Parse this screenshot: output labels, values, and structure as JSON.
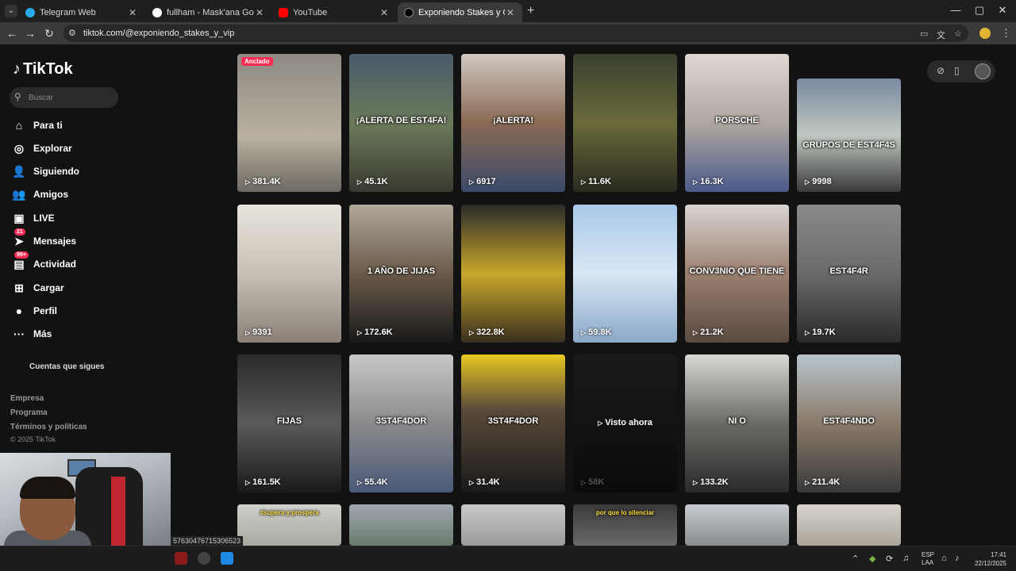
{
  "browser": {
    "tabs": [
      {
        "title": "Telegram Web",
        "color": "#2aabee",
        "active": false
      },
      {
        "title": "fullham - Mask'ana Google",
        "color": "#ffffff",
        "active": false
      },
      {
        "title": "YouTube",
        "color": "#ff0000",
        "active": false
      },
      {
        "title": "Exponiendo Stakes y Grupos Vi",
        "color": "#000000",
        "active": true
      }
    ],
    "url": "tiktok.com/@exponiendo_stakes_y_vip"
  },
  "tiktok": {
    "logo": "TikTok",
    "search_placeholder": "Buscar",
    "nav": [
      {
        "label": "Para ti",
        "icon": "home-icon",
        "glyph": "⌂"
      },
      {
        "label": "Explorar",
        "icon": "compass-icon",
        "glyph": "◎"
      },
      {
        "label": "Siguiendo",
        "icon": "following-icon",
        "glyph": "👤"
      },
      {
        "label": "Amigos",
        "icon": "friends-icon",
        "glyph": "👥"
      },
      {
        "label": "LIVE",
        "icon": "live-icon",
        "glyph": "▣"
      },
      {
        "label": "Mensajes",
        "icon": "messages-icon",
        "glyph": "➤",
        "badge": "21"
      },
      {
        "label": "Actividad",
        "icon": "activity-icon",
        "glyph": "▤",
        "badge": "99+"
      },
      {
        "label": "Cargar",
        "icon": "upload-icon",
        "glyph": "⊞"
      },
      {
        "label": "Perfil",
        "icon": "profile-icon",
        "glyph": "●"
      },
      {
        "label": "Más",
        "icon": "more-icon",
        "glyph": "···"
      }
    ],
    "following_accounts": "Cuentas que sigues",
    "footer": [
      "Empresa",
      "Programa",
      "Términos y políticas"
    ],
    "copyright": "© 2025 TikTok"
  },
  "videos": [
    {
      "views": "381.4K",
      "caption": "",
      "pinned": "Anclado",
      "bg": "linear-gradient(180deg,#8e8a83,#b9b0a0 60%,#6e6a63)"
    },
    {
      "views": "45.1K",
      "caption": "¡ALERTA DE EST4FA!",
      "bg": "linear-gradient(180deg,#4a5a6a,#6b7a5a 50%,#3a3a30)"
    },
    {
      "views": "6917",
      "caption": "¡ALERTA!",
      "bg": "linear-gradient(180deg,#d0c8c0,#8a6a55 50%,#3a4a6a)"
    },
    {
      "views": "11.6K",
      "caption": "",
      "bg": "linear-gradient(180deg,#3a4030,#6a6a3a 50%,#2a2a20)"
    },
    {
      "views": "16.3K",
      "caption": "PORSCHE",
      "bg": "linear-gradient(180deg,#e0d8d0,#b0a8a0 50%,#4a5a8a)"
    },
    {
      "views": "9998",
      "caption": "GRUPOS DE EST4F4S",
      "bg": "linear-gradient(180deg,#7a8aa0,#c0c8c0 50%,#3a3a3a)"
    },
    {
      "views": "9391",
      "caption": "",
      "bg": "linear-gradient(180deg,#e8e4de,#c8c0b4 50%,#8a8078)"
    },
    {
      "views": "172.6K",
      "caption": "1 AÑO DE JIJAS",
      "bg": "linear-gradient(180deg,#b0a89a,#6a5a4a 50%,#1a1a1a)"
    },
    {
      "views": "322.8K",
      "caption": "",
      "bg": "linear-gradient(180deg,#2a2a2a,#c8a82a 50%,#3a3020)"
    },
    {
      "views": "59.8K",
      "caption": "",
      "bg": "linear-gradient(180deg,#a8c8e8,#d8e8f4 50%,#8aa8c8)"
    },
    {
      "views": "21.2K",
      "caption": "CONV3NIO QUE TIENE",
      "bg": "linear-gradient(180deg,#d8d4d0,#9a8070 50%,#5a4a40)"
    },
    {
      "views": "19.7K",
      "caption": "EST4F4R",
      "bg": "linear-gradient(180deg,#8a8a8a,#6a6a6a 50%,#2a2a2a)"
    },
    {
      "views": "161.5K",
      "caption": "FIJAS",
      "bg": "linear-gradient(180deg,#2a2a2a,#5a5a58 50%,#1a1a1a)"
    },
    {
      "views": "55.4K",
      "caption": "3ST4F4DOR",
      "bg": "linear-gradient(180deg,#c8c8c8,#8a8a8a 50%,#4a5a7a)"
    },
    {
      "views": "31.4K",
      "caption": "3ST4F4DOR",
      "bg": "linear-gradient(180deg,#e8c820,#5a4a3a 40%,#1a1a1a)"
    },
    {
      "views": "58K",
      "caption": "",
      "watched": "Visto ahora",
      "bg": "linear-gradient(180deg,#3a3a3a,#2a2a2a 50%,#1a1a1a)"
    },
    {
      "views": "133.2K",
      "caption": "NI O",
      "bg": "linear-gradient(180deg,#d8d8d4,#6a6a66 50%,#2a2a2a)"
    },
    {
      "views": "211.4K",
      "caption": "EST4F4NDO",
      "bg": "linear-gradient(180deg,#b8c4cc,#8a7a6a 50%,#3a3a3a)"
    },
    {
      "views": "",
      "caption": "#supera y prospera",
      "bg": "linear-gradient(180deg,#d0d0cc,#a8a8a0)"
    },
    {
      "views": "",
      "caption": "",
      "bg": "linear-gradient(180deg,#a0a8b0,#6a7a6a)"
    },
    {
      "views": "",
      "caption": "",
      "bg": "linear-gradient(180deg,#c8c8c8,#9a9a9a)"
    },
    {
      "views": "",
      "caption": "por que lo silenciar",
      "bg": "linear-gradient(180deg,#3a3a3a,#6a6a6a)"
    },
    {
      "views": "",
      "caption": "",
      "bg": "linear-gradient(180deg,#c8ccd0,#8a8c8e)"
    },
    {
      "views": "",
      "caption": "",
      "bg": "linear-gradient(180deg,#d8d4cc,#aaa49a)"
    }
  ],
  "overlay": {
    "hover_link": "57630476715306523"
  },
  "taskbar": {
    "lang_line1": "ESP",
    "lang_line2": "LAA",
    "time": "17:41",
    "date": "22/12/2025"
  }
}
